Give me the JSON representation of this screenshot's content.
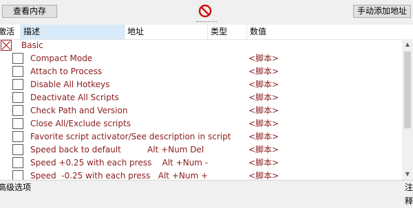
{
  "toolbar": {
    "view_memory_label": "查看内存",
    "add_address_label": "手动添加地址"
  },
  "columns": {
    "active": "激活",
    "description": "描述",
    "address": "地址",
    "type": "类型",
    "value": "数值"
  },
  "rows": [
    {
      "description": "Basic",
      "value": ""
    },
    {
      "description": "Compact Mode",
      "value": "<脚本>"
    },
    {
      "description": "Attach to Process",
      "value": "<脚本>"
    },
    {
      "description": "Disable All Hotkeys",
      "value": "<脚本>"
    },
    {
      "description": "Deactivate All Scripts",
      "value": "<脚本>"
    },
    {
      "description": "Check Path and Version",
      "value": "<脚本>"
    },
    {
      "description": "Close All/Exclude scripts",
      "value": "<脚本>"
    },
    {
      "description": "Favorite script activator/See description in script",
      "value": "<脚本>"
    },
    {
      "description": "Speed back to default          Alt +Num Del",
      "value": "<脚本>"
    },
    {
      "description": "Speed +0.25 with each press    Alt +Num -",
      "value": "<脚本>"
    },
    {
      "description": "Speed  -0.25 with each press   Alt +Num +",
      "value": "<脚本>"
    }
  ],
  "footer": {
    "advanced_label": "高级选项",
    "comments_label": "注释"
  },
  "colors": {
    "script_text": "#8b1a1a",
    "selected_header": "#d9ebf9"
  }
}
